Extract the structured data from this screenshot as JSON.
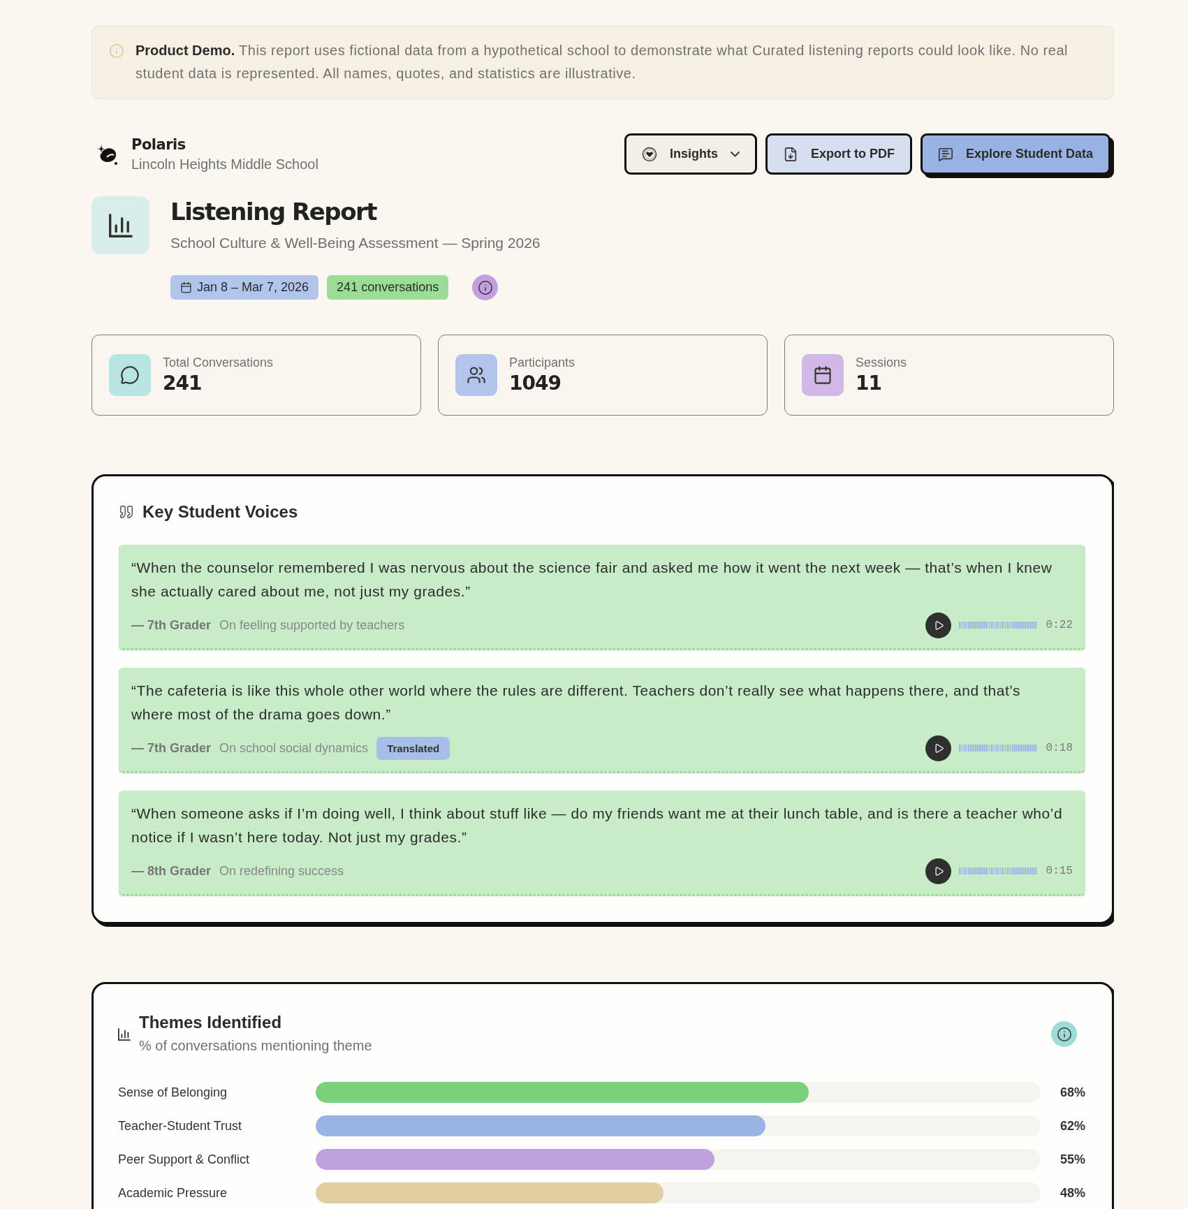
{
  "banner": {
    "text": "**Product Demo.** This report uses fictional data from a hypothetical school to demonstrate what Curated listening reports could look like. No real student data is represented. All names, quotes, and statistics are illustrative."
  },
  "brand": {
    "name": "Polaris",
    "school": "Lincoln Heights Middle School"
  },
  "actions": [
    {
      "kind": "dropdown",
      "label": "Insights"
    },
    {
      "kind": "export",
      "label": "Export to PDF"
    },
    {
      "kind": "primary",
      "label": "Explore Student Data"
    }
  ],
  "report": {
    "title": "Listening Report",
    "subtitle": "School Culture & Well-Being Assessment — Spring 2026",
    "date_range": "Jan 8 – Mar 7, 2026",
    "conversations": "241 conversations"
  },
  "stats": [
    {
      "kind": "conversations",
      "label": "Total Conversations",
      "value": "241"
    },
    {
      "kind": "participants",
      "label": "Participants",
      "value": "1049"
    },
    {
      "kind": "sessions",
      "label": "Sessions",
      "value": "11"
    }
  ],
  "voices": {
    "title": "Key Student Voices",
    "quotes": [
      {
        "text": "“When the counselor remembered I was nervous about the science fair and asked me how it went the next week — that’s when I knew she actually cared about me, not just my grades.”",
        "grade": "— 7th Grader",
        "topic": "On feeling supported by teachers",
        "duration": "0:22"
      },
      {
        "text": "“The cafeteria is like this whole other world where the rules are different. Teachers don’t really see what happens there, and that’s where most of the drama goes down.”",
        "grade": "— 7th Grader",
        "topic": "On school social dynamics",
        "badge": "Translated",
        "duration": "0:18"
      },
      {
        "text": "“When someone asks if I’m doing well, I think about stuff like — do my friends want me at their lunch table, and is there a teacher who’d notice if I wasn’t here today. Not just my grades.”",
        "grade": "— 8th Grader",
        "topic": "On redefining success",
        "duration": "0:15"
      }
    ]
  },
  "themes": {
    "title": "Themes Identified",
    "subtitle": "% of conversations mentioning theme",
    "items": [
      {
        "label": "Sense of Belonging",
        "level": 0.68,
        "value": "68%",
        "color": "#7ad17a"
      },
      {
        "label": "Teacher-Student Trust",
        "level": 0.62,
        "value": "62%",
        "color": "#99b3e3"
      },
      {
        "label": "Peer Support & Conflict",
        "level": 0.55,
        "value": "55%",
        "color": "#bfa1de"
      },
      {
        "label": "Academic Pressure",
        "level": 0.48,
        "value": "48%",
        "color": "#dfcfa0"
      }
    ]
  }
}
